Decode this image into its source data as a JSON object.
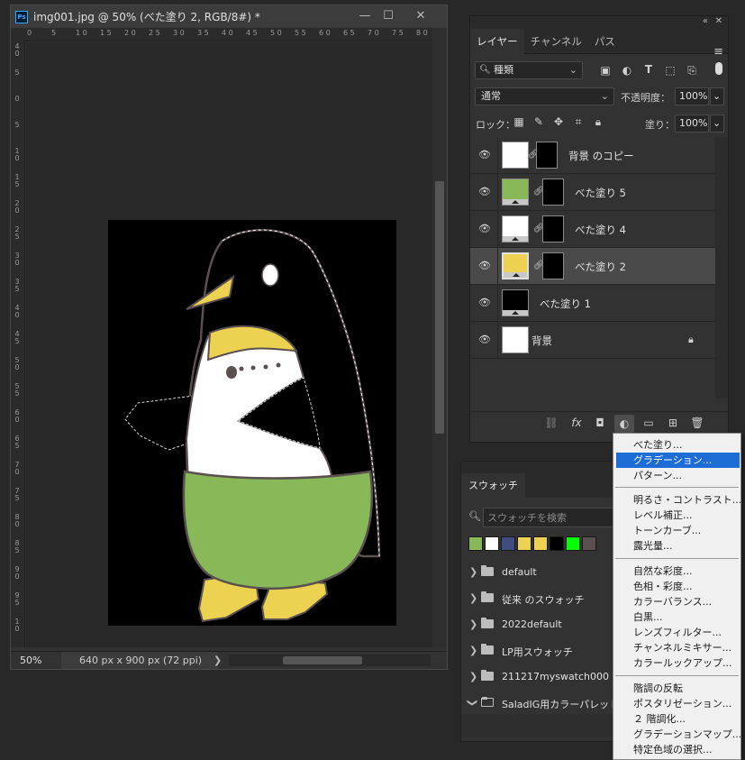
{
  "document": {
    "title": "img001.jpg @ 50% (べた塗り 2, RGB/8#) *",
    "ps_badge": "Ps",
    "window_buttons": [
      "—",
      "☐",
      "✕"
    ],
    "ruler_top": [
      "0",
      "5",
      "1 0",
      "1 5",
      "2 0",
      "2 5",
      "3 0",
      "3 5",
      "4 0",
      "4 5",
      "5 0",
      "5 5",
      "6 0",
      "6 5",
      "7 0",
      "7 5",
      "8 0"
    ],
    "ruler_left": [
      "4 0",
      "5",
      "0",
      "5",
      "1 0",
      "1 5",
      "2 0",
      "2 5",
      "3 0",
      "3 5",
      "4 0",
      "4 5",
      "5 0",
      "5 5",
      "6 0",
      "6 5",
      "7 0",
      "7 5",
      "8 0",
      "8 5",
      "9 0",
      "9 5",
      "1 0"
    ],
    "zoom": "50%",
    "doc_size": "640 px x 900 px (72 ppi)",
    "status_arrow": "❯",
    "colors": {
      "artboard": "#000000",
      "penguin_green": "#88b858",
      "penguin_yellow": "#ecd250",
      "penguin_white": "#ffffff",
      "outline": "#5a5050"
    }
  },
  "layers_panel": {
    "collapse_icon": "«",
    "close_icon": "✕",
    "tabs": [
      "レイヤー",
      "チャンネル",
      "パス"
    ],
    "menu_icon": "≡",
    "filter_kind": "種類",
    "filter_icon": "search-icon",
    "blend_mode": "通常",
    "opacity_label": "不透明度：",
    "opacity_value": "100%",
    "lock_label": "ロック：",
    "fill_label": "塗り：",
    "fill_value": "100%",
    "layers": [
      {
        "name": "背景 のコピー",
        "thumb_color": "#ffffff",
        "has_mask": true,
        "selected": false,
        "locked": false
      },
      {
        "name": "べた塗り 5",
        "thumb_color": "#88b858",
        "has_mask": true,
        "selected": false,
        "locked": false
      },
      {
        "name": "べた塗り 4",
        "thumb_color": "#ffffff",
        "has_mask": true,
        "selected": false,
        "locked": false
      },
      {
        "name": "べた塗り 2",
        "thumb_color": "#ecd250",
        "has_mask": true,
        "selected": true,
        "locked": false
      },
      {
        "name": "べた塗り 1",
        "thumb_color": "#000000",
        "has_mask": false,
        "selected": false,
        "locked": false
      },
      {
        "name": "背景",
        "thumb_color": "#ffffff",
        "has_mask": false,
        "selected": false,
        "locked": true
      }
    ],
    "footer_icons": [
      "link-icon",
      "fx-icon",
      "mask-icon",
      "adjustment-icon",
      "folder-icon",
      "new-layer-icon",
      "trash-icon"
    ],
    "fx_label": "fx"
  },
  "swatches_panel": {
    "tab": "スウォッチ",
    "search_placeholder": "スウォッチを検索",
    "colors": [
      "#88b858",
      "#ffffff",
      "#3f4d80",
      "#ecd250",
      "#ecd250",
      "#000000",
      "#00ff00",
      "#5a5050"
    ],
    "folders": [
      "default",
      "従来 のスウォッチ",
      "2022default",
      "LP用スウォッチ",
      "211217myswatch000",
      "SaladIG用カラーパレット"
    ]
  },
  "adjustment_menu": {
    "groups": [
      [
        "べた塗り...",
        "グラデーション...",
        "パターン..."
      ],
      [
        "明るさ・コントラスト...",
        "レベル補正...",
        "トーンカーブ...",
        "露光量..."
      ],
      [
        "自然な彩度...",
        "色相・彩度...",
        "カラーバランス...",
        "白黒...",
        "レンズフィルター...",
        "チャンネルミキサー...",
        "カラールックアップ..."
      ],
      [
        "階調の反転",
        "ポスタリゼーション...",
        "２ 階調化...",
        "グラデーションマップ...",
        "特定色域の選択..."
      ]
    ],
    "highlighted": "グラデーション..."
  }
}
